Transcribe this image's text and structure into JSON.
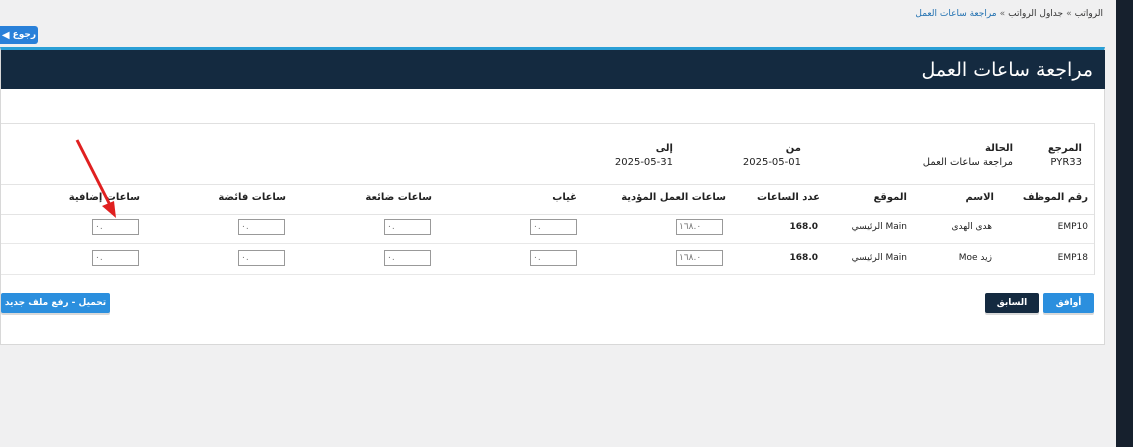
{
  "breadcrumb": {
    "item1": "الرواتب",
    "item2": "جداول الرواتب",
    "current": "مراجعة ساعات العمل",
    "sep": "»"
  },
  "back_button": {
    "label": "رجوع",
    "icon": "arrow-left-icon"
  },
  "page": {
    "title": "مراجعة ساعات العمل"
  },
  "meta": {
    "reference": {
      "label": "المرجع",
      "value": "PYR33"
    },
    "status": {
      "label": "الحالة",
      "value": "مراجعة ساعات العمل"
    },
    "from": {
      "label": "من",
      "value": "2025-05-01"
    },
    "to": {
      "label": "إلى",
      "value": "2025-05-31"
    }
  },
  "table": {
    "headers": {
      "emp_id": "رقم الموظف",
      "name": "الاسم",
      "location": "الموقع",
      "hours": "عدد الساعات",
      "worked": "ساعات العمل المؤدية",
      "absence": "غياب",
      "lost": "ساعات ضائعة",
      "surplus": "ساعات فائضة",
      "extra": "ساعات إضافية"
    },
    "rows": [
      {
        "emp_id": "EMP10",
        "name": "هدى الهدى",
        "location": "Main الرئيسي",
        "hours": "168.0",
        "worked": "١٦٨.٠",
        "absence": "٠.",
        "lost": "٠.",
        "surplus": "٠.",
        "extra": "٠."
      },
      {
        "emp_id": "EMP18",
        "name": "زيد Moe",
        "location": "Main الرئيسي",
        "hours": "168.0",
        "worked": "١٦٨.٠",
        "absence": "٠.",
        "lost": "٠.",
        "surplus": "٠.",
        "extra": "٠."
      }
    ]
  },
  "actions": {
    "approve": "أوافق",
    "previous": "السابق",
    "upload": "تحميل - رفع ملف جديد"
  },
  "colors": {
    "header_bg": "#142a40",
    "accent": "#2b8fde",
    "annotation_arrow": "#e02020"
  }
}
